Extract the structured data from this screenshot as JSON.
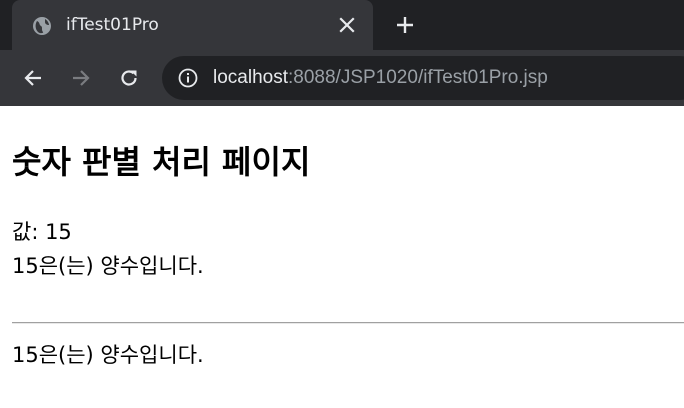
{
  "tab": {
    "title": "ifTest01Pro"
  },
  "address_bar": {
    "host": "localhost",
    "rest": ":8088/JSP1020/ifTest01Pro.jsp"
  },
  "page": {
    "heading": "숫자 판별 처리 페이지",
    "value_line": "값: 15",
    "result_line_1": "15은(는) 양수입니다.",
    "result_line_2": "15은(는) 양수입니다."
  },
  "icons": {
    "favicon": "globe-icon",
    "tab_close": "close-icon",
    "new_tab": "plus-icon",
    "back": "arrow-left-icon",
    "forward": "arrow-right-icon",
    "reload": "reload-icon",
    "site_info": "info-icon"
  },
  "colors": {
    "tabstrip": "#202124",
    "toolbar": "#35363a",
    "omnibox": "#202124",
    "url_host": "#e8eaed",
    "url_rest": "#9aa0a6"
  }
}
